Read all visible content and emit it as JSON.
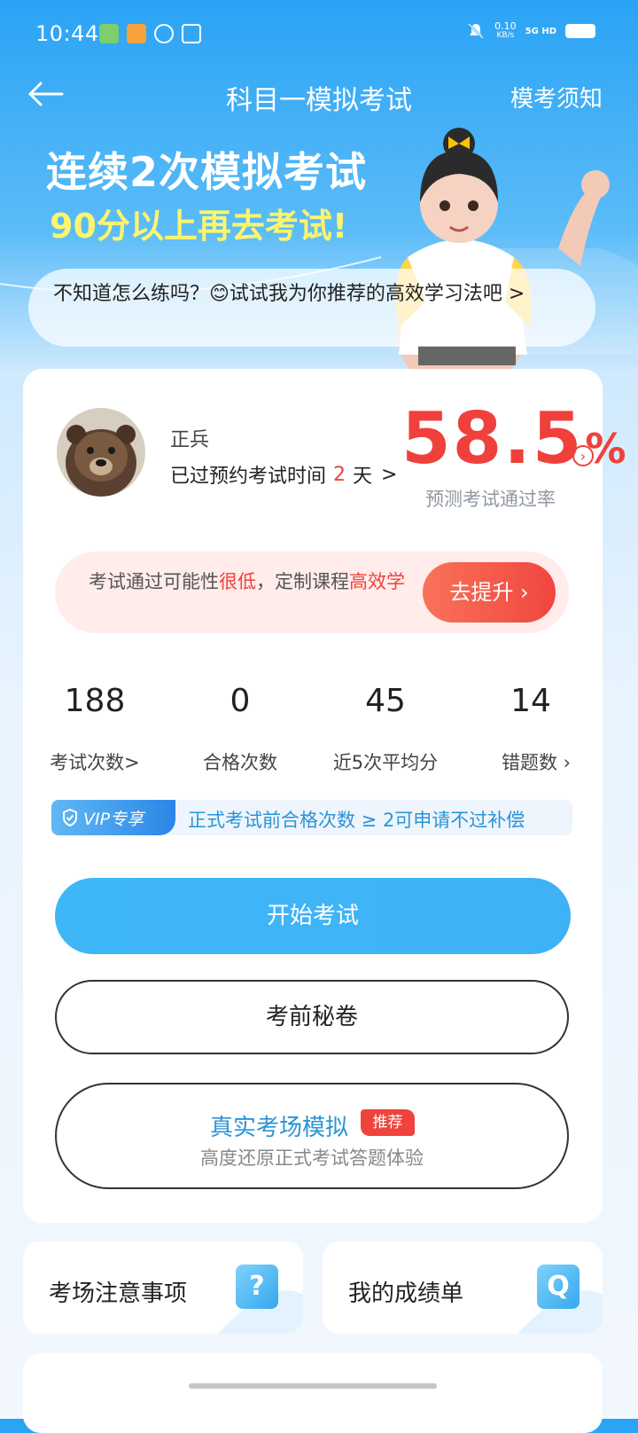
{
  "status_bar": {
    "time": "10:44",
    "net_speed": "0.10",
    "net_unit": "KB/s",
    "network": "5G HD"
  },
  "nav": {
    "title": "科目一模拟考试",
    "right_link": "模考须知"
  },
  "hero": {
    "line1": "连续2次模拟考试",
    "line2": "90分以上再去考试!"
  },
  "tip": {
    "text": "不知道怎么练吗？😊试试我为你推荐的高效学习法吧 >"
  },
  "profile": {
    "name": "正兵",
    "appt_prefix": "已过预约考试时间",
    "appt_days": "2",
    "appt_suffix": "天",
    "appt_arrow": ">"
  },
  "pass_rate": {
    "value": "58.5",
    "unit": "%",
    "label": "预测考试通过率",
    "arrow": "›"
  },
  "warning": {
    "text_a": "考试通过可能性",
    "text_b": "很低",
    "text_c": "，定制课程",
    "text_d": "高效学",
    "button": "去提升 ›"
  },
  "stats": [
    {
      "value": "188",
      "label": "考试次数>"
    },
    {
      "value": "0",
      "label": "合格次数"
    },
    {
      "value": "45",
      "label": "近5次平均分"
    },
    {
      "value": "14",
      "label": "错题数 ›"
    }
  ],
  "vip": {
    "tag": "VIP专享",
    "text": "正式考试前合格次数 ≥ 2可申请不过补偿"
  },
  "buttons": {
    "start": "开始考试",
    "secret": "考前秘卷",
    "real_title": "真实考场模拟",
    "real_badge": "推荐",
    "real_sub": "高度还原正式考试答题体验"
  },
  "tiles": [
    {
      "label": "考场注意事项",
      "icon": "?"
    },
    {
      "label": "我的成绩单",
      "icon": "Q"
    }
  ],
  "colors": {
    "primary": "#3fb6f8",
    "danger": "#f0413a",
    "highlight": "#fff46c"
  }
}
